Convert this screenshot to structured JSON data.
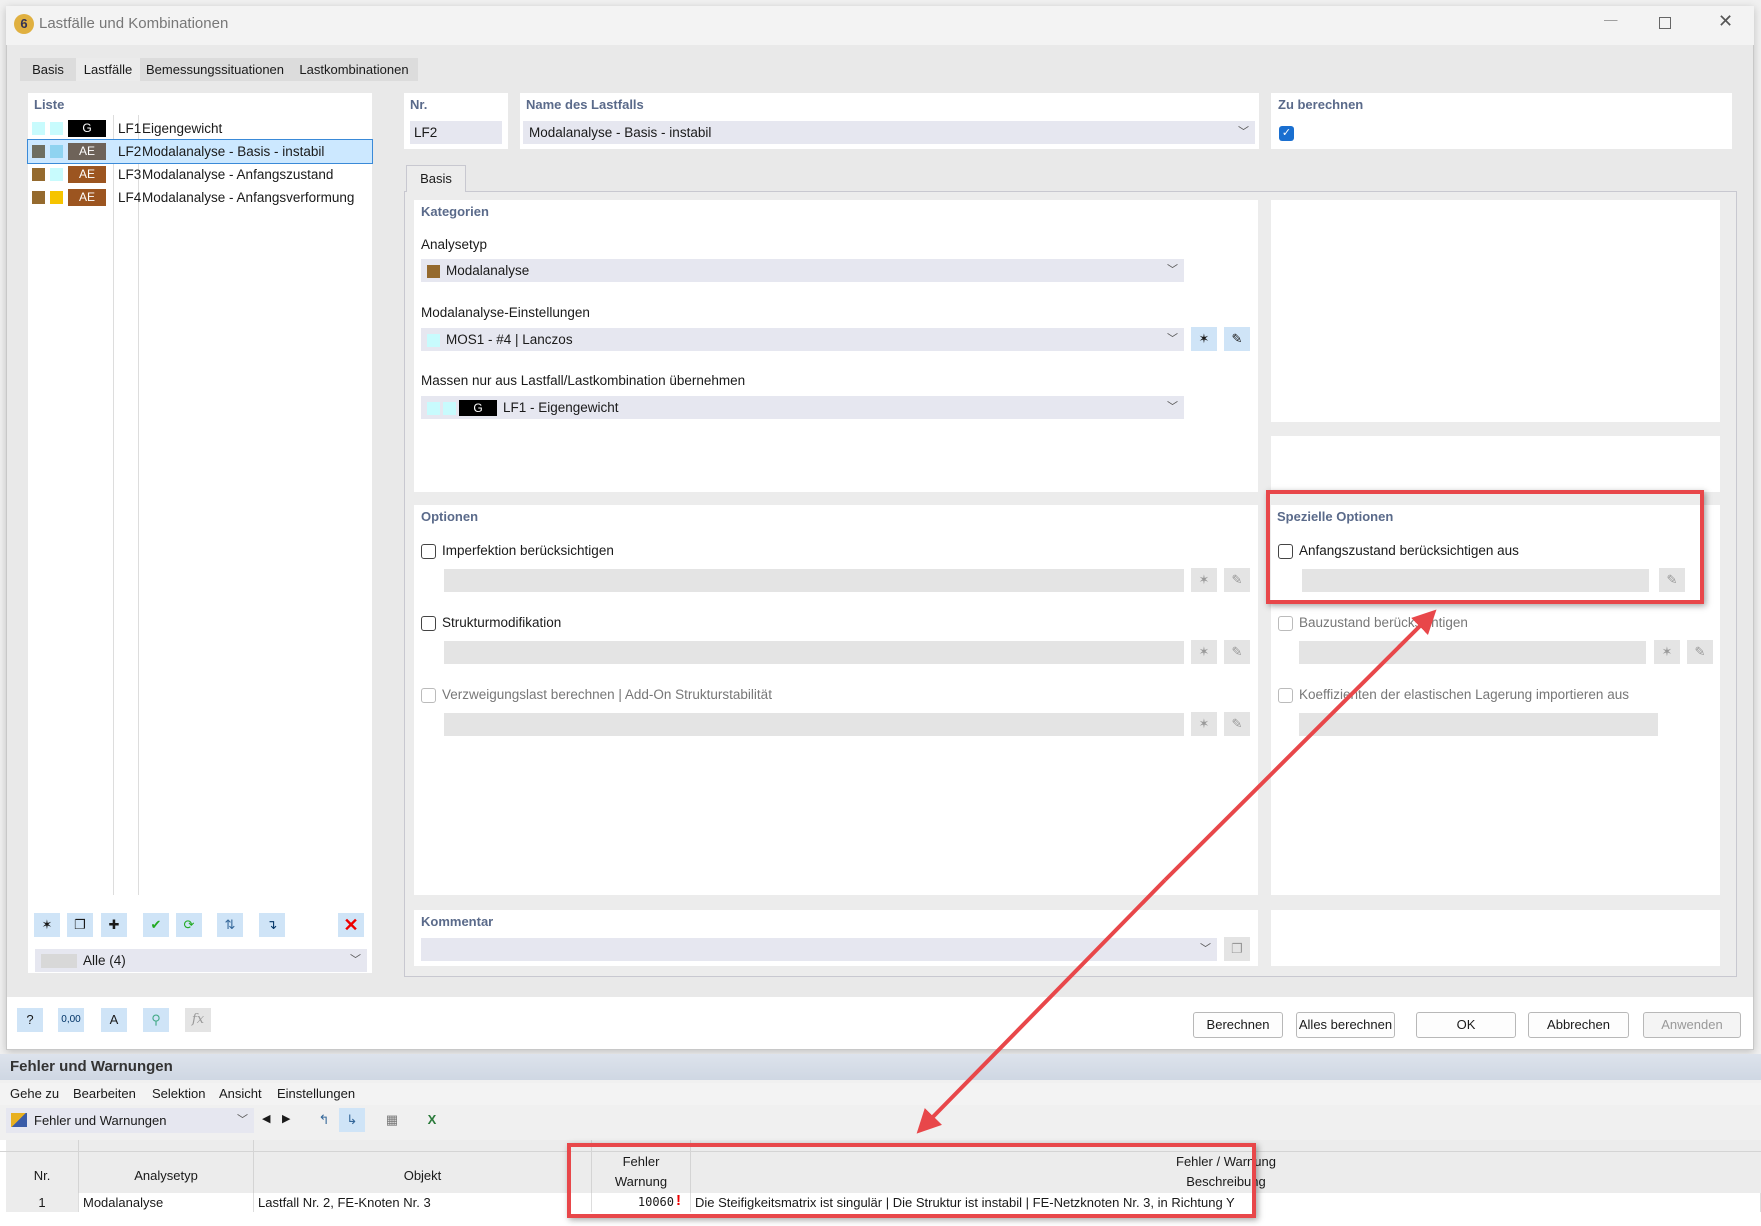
{
  "window": {
    "title": "Lastfälle und Kombinationen",
    "tabs": [
      "Basis",
      "Lastfälle",
      "Bemessungssituationen",
      "Lastkombinationen"
    ],
    "active_tab": "Lastfälle"
  },
  "list": {
    "header": "Liste",
    "items": [
      {
        "id": "LF1",
        "name": "Eigengewicht",
        "tag": "G",
        "colors": [
          "#c8fbfd",
          "#c8fbfd",
          "#000000"
        ]
      },
      {
        "id": "LF2",
        "name": "Modalanalyse - Basis - instabil",
        "tag": "AE",
        "colors": [
          "#6e6e60",
          "#8fd3f0",
          "#6e6359"
        ],
        "selected": true
      },
      {
        "id": "LF3",
        "name": "Modalanalyse - Anfangszustand",
        "tag": "AE",
        "colors": [
          "#956a2e",
          "#c8fbfd",
          "#9c5520"
        ]
      },
      {
        "id": "LF4",
        "name": "Modalanalyse - Anfangsverformung",
        "tag": "AE",
        "colors": [
          "#956a2e",
          "#f6c400",
          "#9c5520"
        ]
      }
    ],
    "filter": "Alle (4)"
  },
  "nr": {
    "label": "Nr.",
    "value": "LF2"
  },
  "name": {
    "label": "Name des Lastfalls",
    "value": "Modalanalyse - Basis - instabil"
  },
  "zu_berechnen": {
    "label": "Zu berechnen",
    "checked": true
  },
  "subtab": "Basis",
  "kategorien": {
    "header": "Kategorien",
    "analysetyp_label": "Analysetyp",
    "analysetyp": "Modalanalyse",
    "modal_label": "Modalanalyse-Einstellungen",
    "modal": "MOS1 - #4 | Lanczos",
    "massen_label": "Massen nur aus Lastfall/Lastkombination übernehmen",
    "massen_tag": "G",
    "massen": "LF1 - Eigengewicht"
  },
  "optionen": {
    "header": "Optionen",
    "items": [
      {
        "label": "Imperfektion berücksichtigen",
        "enabled": true
      },
      {
        "label": "Strukturmodifikation",
        "enabled": true
      },
      {
        "label": "Verzweigungslast berechnen | Add-On Strukturstabilität",
        "enabled": false
      }
    ]
  },
  "spezielle": {
    "header": "Spezielle Optionen",
    "items": [
      {
        "label": "Anfangszustand berücksichtigen aus",
        "enabled": true
      },
      {
        "label": "Bauzustand berücksichtigen",
        "enabled": false
      },
      {
        "label": "Koeffizienten der elastischen Lagerung importieren aus",
        "enabled": false
      }
    ]
  },
  "kommentar": {
    "header": "Kommentar"
  },
  "buttons": {
    "berechnen": "Berechnen",
    "alles": "Alles berechnen",
    "ok": "OK",
    "abbrechen": "Abbrechen",
    "anwenden": "Anwenden"
  },
  "errors": {
    "title": "Fehler und Warnungen",
    "menu": [
      "Gehe zu",
      "Bearbeiten",
      "Selektion",
      "Ansicht",
      "Einstellungen"
    ],
    "dropdown": "Fehler und Warnungen",
    "columns": {
      "nr": "Nr.",
      "analysetyp": "Analysetyp",
      "objekt": "Objekt",
      "fehler1": "Fehler",
      "fehler2": "Warnung",
      "beschr1": "Fehler / Warnung",
      "beschr2": "Beschreibung"
    },
    "rows": [
      {
        "nr": "1",
        "analysetyp": "Modalanalyse",
        "objekt": "Lastfall Nr. 2, FE-Knoten Nr. 3",
        "code": "10060",
        "beschreibung": "Die Steifigkeitsmatrix ist singulär |  Die Struktur ist instabil | FE-Netzknoten Nr. 3, in Richtung Y"
      }
    ]
  },
  "colors": {
    "accent": "#e8474a",
    "selection": "#cce8ff",
    "header_text": "#5a6a8a"
  }
}
